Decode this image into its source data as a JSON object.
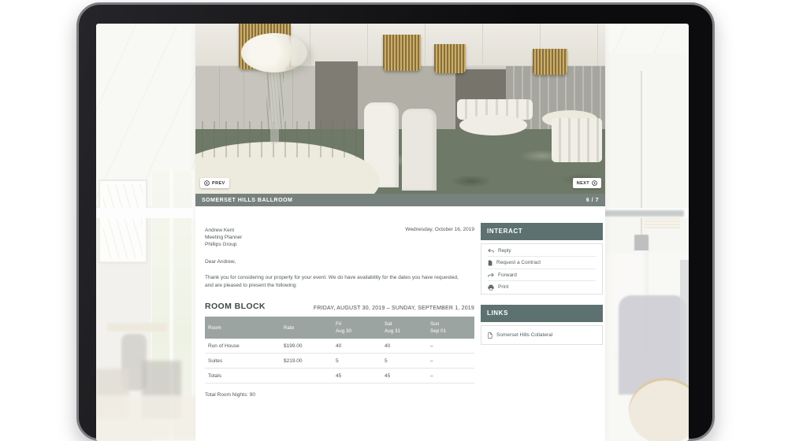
{
  "colors": {
    "accent_slate": "#5d7170",
    "table_header_bg": "#9ba4a1",
    "caption_bar_bg": "#5f6b66",
    "body_text": "#4e5a58"
  },
  "carousel": {
    "prev_label": "PREV",
    "next_label": "NEXT",
    "caption": "SOMERSET HILLS BALLROOM",
    "pagination": "6 / 7"
  },
  "letter": {
    "recipient_name": "Andrew Kent",
    "recipient_title": "Meeting Planner",
    "recipient_company": "Phillips Group",
    "date": "Wednesday, October 16, 2019",
    "salutation": "Dear Andrew,",
    "body": "Thank you for considering our property for your event. We do have availability for the dates you have requested, and are pleased to present the following:"
  },
  "room_block": {
    "title": "ROOM BLOCK",
    "date_range": "FRIDAY, AUGUST 30, 2019  –  SUNDAY, SEPTEMBER 1, 2019",
    "table": {
      "headers": [
        {
          "label": "Room",
          "sub": ""
        },
        {
          "label": "Rate",
          "sub": ""
        },
        {
          "label": "Fri",
          "sub": "Aug 30"
        },
        {
          "label": "Sat",
          "sub": "Aug 31"
        },
        {
          "label": "Sun",
          "sub": "Sep 01"
        }
      ],
      "rows": [
        {
          "room": "Run of House",
          "rate": "$199.00",
          "fri": "40",
          "sat": "40",
          "sun": "–"
        },
        {
          "room": "Suites",
          "rate": "$219.00",
          "fri": "5",
          "sat": "5",
          "sun": "–"
        },
        {
          "room": "Totals",
          "rate": "",
          "fri": "45",
          "sat": "45",
          "sun": "–"
        }
      ]
    },
    "total_note": "Total Room Nights: 90"
  },
  "interact": {
    "title": "INTERACT",
    "items": [
      {
        "label": "Reply",
        "icon": "reply-icon"
      },
      {
        "label": "Request a Contract",
        "icon": "contract-icon"
      },
      {
        "label": "Forward",
        "icon": "forward-icon"
      },
      {
        "label": "Print",
        "icon": "print-icon"
      }
    ]
  },
  "links": {
    "title": "LINKS",
    "items": [
      {
        "label": "Somerset Hills Collateral",
        "icon": "document-icon"
      }
    ]
  }
}
